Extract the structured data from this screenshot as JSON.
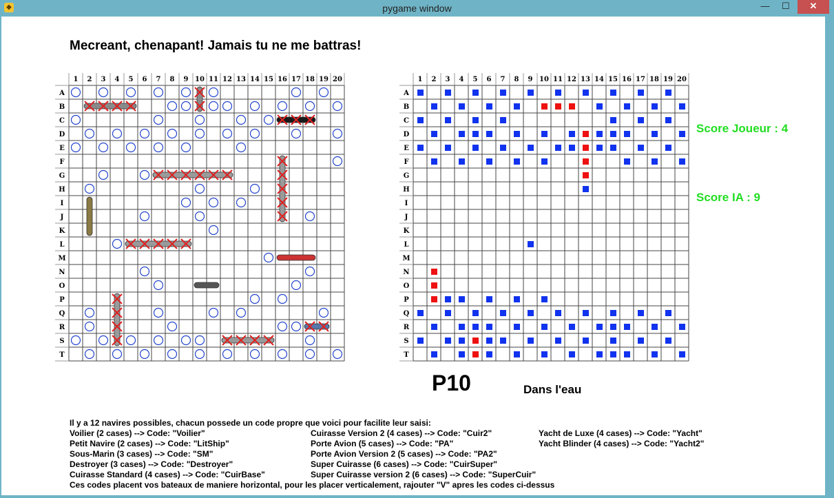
{
  "window": {
    "title": "pygame window",
    "icon": "pygame-snake-icon",
    "minimize_label": "—",
    "maximize_label": "☐",
    "close_label": "✕"
  },
  "headline": "Mecreant, chenapant! Jamais tu ne me battras!",
  "columns": [
    "1",
    "2",
    "3",
    "4",
    "5",
    "6",
    "7",
    "8",
    "9",
    "10",
    "11",
    "12",
    "13",
    "14",
    "15",
    "16",
    "17",
    "18",
    "19",
    "20"
  ],
  "rows": [
    "A",
    "B",
    "C",
    "D",
    "E",
    "F",
    "G",
    "H",
    "I",
    "J",
    "K",
    "L",
    "M",
    "N",
    "O",
    "P",
    "Q",
    "R",
    "S",
    "T"
  ],
  "colors": {
    "miss_marker_left": "#2244cc",
    "hit_cross": "#dd2222",
    "miss_square": "#1133ee",
    "hit_square": "#ee1111",
    "score": "#22dd22"
  },
  "player_board": {
    "misses": [
      "A1",
      "A3",
      "A5",
      "A7",
      "A9",
      "A11",
      "A17",
      "A19",
      "B8",
      "B9",
      "B11",
      "B12",
      "B14",
      "B16",
      "B18",
      "B20",
      "C1",
      "C7",
      "C10",
      "C13",
      "C15",
      "D2",
      "D4",
      "D6",
      "D8",
      "D10",
      "D12",
      "D14",
      "D17",
      "D20",
      "E1",
      "E3",
      "E5",
      "E7",
      "E9",
      "E13",
      "F20",
      "G3",
      "G6",
      "H2",
      "H10",
      "H14",
      "I9",
      "I11",
      "I13",
      "J6",
      "J10",
      "J18",
      "K11",
      "L4",
      "M15",
      "N6",
      "N18",
      "O7",
      "O17",
      "P14",
      "P16",
      "Q2",
      "Q7",
      "Q11",
      "Q13",
      "Q19",
      "R2",
      "R8",
      "R16",
      "R17",
      "S1",
      "S3",
      "S5",
      "S7",
      "S9",
      "S10",
      "S18",
      "T2",
      "T4",
      "T6",
      "T8",
      "T10",
      "T12",
      "T14",
      "T16",
      "T18",
      "T20"
    ],
    "hits": [
      "B2",
      "B3",
      "B4",
      "B5",
      "C16",
      "C17",
      "C18",
      "G7",
      "G8",
      "G9",
      "G10",
      "G11",
      "G12",
      "A10",
      "B10",
      "F16",
      "G16",
      "H16",
      "I16",
      "J16",
      "L5",
      "L6",
      "L7",
      "L8",
      "L9",
      "P4",
      "Q4",
      "R4",
      "S4",
      "R18",
      "R19",
      "S12",
      "S13",
      "S14",
      "S15"
    ],
    "ships": [
      {
        "name": "cuirasse-horizontal",
        "cells": [
          "B2",
          "B5"
        ],
        "color": "#8a8a8a"
      },
      {
        "name": "destroyer-vertical",
        "cells": [
          "A10",
          "B10"
        ],
        "color": "#8a8a8a"
      },
      {
        "name": "black-ship",
        "cells": [
          "C16",
          "C18"
        ],
        "color": "#1a1a1a"
      },
      {
        "name": "grey-ship-g",
        "cells": [
          "G7",
          "G12"
        ],
        "color": "#9a9a9a"
      },
      {
        "name": "vertical-ship-16",
        "cells": [
          "F16",
          "J16"
        ],
        "color": "#9a9a9a"
      },
      {
        "name": "voilier-vertical",
        "cells": [
          "I2",
          "K2"
        ],
        "color": "#8b7a45"
      },
      {
        "name": "grey-ship-l",
        "cells": [
          "L5",
          "L9"
        ],
        "color": "#9a9a9a"
      },
      {
        "name": "yacht",
        "cells": [
          "M16",
          "M18"
        ],
        "color": "#cc3333"
      },
      {
        "name": "sous-marin",
        "cells": [
          "O10",
          "O11"
        ],
        "color": "#555555"
      },
      {
        "name": "vertical-ship-4",
        "cells": [
          "P4",
          "S4"
        ],
        "color": "#9a9a9a"
      },
      {
        "name": "small-ship-r",
        "cells": [
          "R18",
          "R19"
        ],
        "color": "#5577aa"
      },
      {
        "name": "grey-ship-s",
        "cells": [
          "S12",
          "S15"
        ],
        "color": "#9a9a9a"
      }
    ]
  },
  "ai_board": {
    "misses": [
      "A1",
      "A3",
      "A5",
      "A7",
      "A9",
      "A11",
      "A13",
      "A15",
      "A17",
      "A19",
      "B2",
      "B4",
      "B6",
      "B8",
      "B14",
      "B16",
      "B18",
      "B20",
      "C1",
      "C3",
      "C5",
      "C7",
      "C15",
      "C17",
      "C19",
      "D2",
      "D4",
      "D5",
      "D6",
      "D8",
      "D10",
      "D12",
      "D14",
      "D15",
      "D16",
      "D18",
      "D20",
      "E1",
      "E3",
      "E5",
      "E7",
      "E9",
      "E11",
      "E12",
      "E14",
      "E15",
      "E17",
      "E19",
      "F2",
      "F4",
      "F6",
      "F8",
      "F10",
      "F16",
      "F18",
      "F20",
      "H13",
      "L9",
      "P3",
      "P4",
      "P6",
      "P8",
      "P10",
      "Q1",
      "Q3",
      "Q5",
      "Q7",
      "Q9",
      "Q11",
      "Q13",
      "Q15",
      "Q17",
      "Q19",
      "R2",
      "R4",
      "R5",
      "R6",
      "R8",
      "R10",
      "R12",
      "R14",
      "R15",
      "R16",
      "R18",
      "R20",
      "S1",
      "S3",
      "S4",
      "S6",
      "S7",
      "S9",
      "S11",
      "S13",
      "S15",
      "S17",
      "S19",
      "T2",
      "T4",
      "T6",
      "T8",
      "T10",
      "T12",
      "T14",
      "T15",
      "T16",
      "T18",
      "T20"
    ],
    "hits": [
      "B10",
      "B11",
      "B12",
      "D13",
      "E13",
      "F13",
      "G13",
      "N2",
      "O2",
      "P2",
      "S5",
      "T5"
    ]
  },
  "scores": {
    "player": "Score Joueur : 4",
    "ai": "Score IA : 9"
  },
  "last_shot": {
    "coordinate": "P10",
    "result": "Dans l'eau"
  },
  "instructions": {
    "intro": "Il y a 12 navires possibles, chacun possede un code propre que voici pour facilite leur saisi:",
    "col1": [
      "Voilier (2 cases) --> Code: \"Voilier\"",
      "Petit Navire (2 cases) --> Code: \"LitShip\"",
      "Sous-Marin (3 cases) --> Code: \"SM\"",
      "Destroyer (3 cases) --> Code: \"Destroyer\"",
      "Cuirasse Standard (4 cases) --> Code: \"CuirBase\""
    ],
    "col2": [
      "Cuirasse Version 2 (4 cases) --> Code: \"Cuir2\"",
      "Porte Avion (5 cases) --> Code: \"PA\"",
      "Porte Avion Version 2 (5 cases) --> Code: \"PA2\"",
      "Super Cuirasse (6 cases) --> Code: \"CuirSuper\"",
      "Super Cuirasse version 2 (6 cases) --> Code: \"SuperCuir\""
    ],
    "col3": [
      "Yacht de Luxe (4 cases) --> Code: \"Yacht\"",
      "Yacht Blinder (4 cases) --> Code: \"Yacht2\""
    ],
    "footer": "Ces codes placent vos bateaux de maniere horizontal, pour les placer verticalement, rajouter \"V\" apres les codes ci-dessus"
  }
}
